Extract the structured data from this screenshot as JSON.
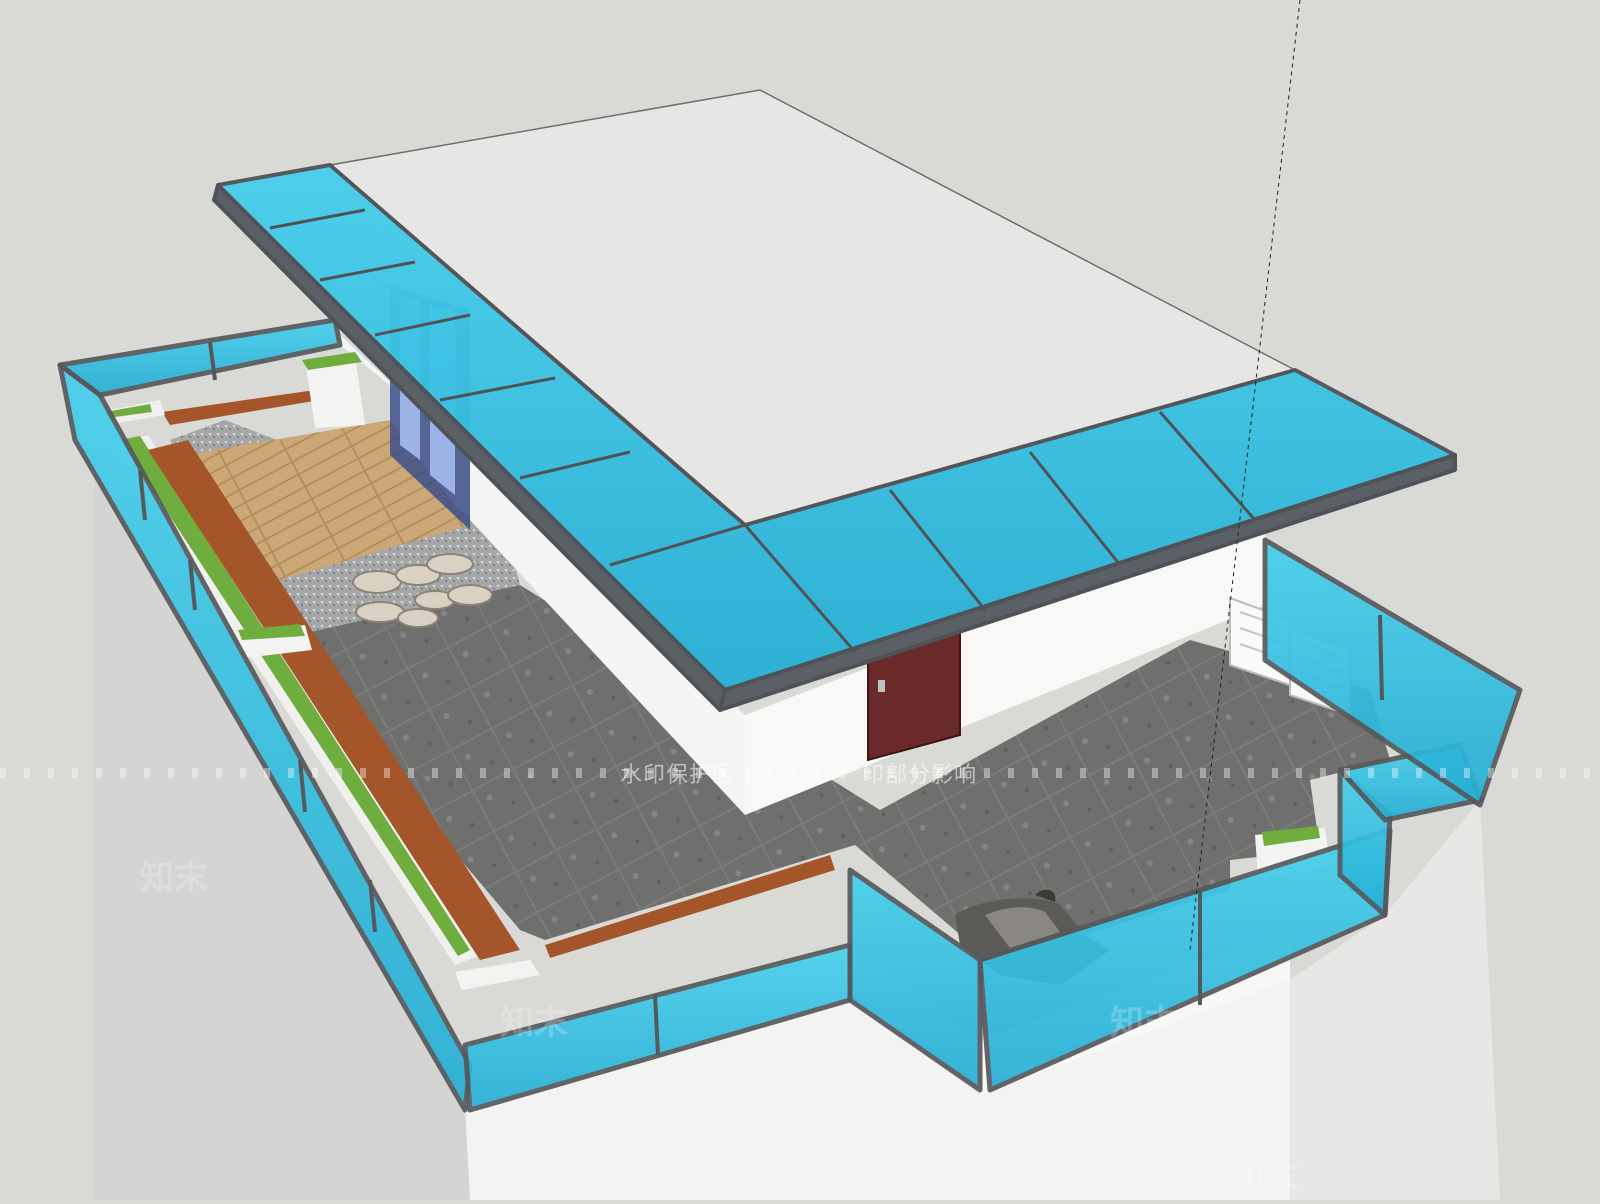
{
  "watermark": {
    "left_text": "水印保护区",
    "right_text": "印部分影响",
    "logo_text": "知末"
  },
  "colors": {
    "background": "#d9dad6",
    "glass": "#3cc4e4",
    "glass_dark": "#1d9fc4",
    "frame": "#5a5f63",
    "wall": "#f1f1ef",
    "roof_top": "#e4e5e3",
    "tile": "#7a7a78",
    "wood_deck": "#c9a574",
    "wood_bench": "#a5562a",
    "grass": "#6da83a",
    "door": "#6a2a2a"
  }
}
